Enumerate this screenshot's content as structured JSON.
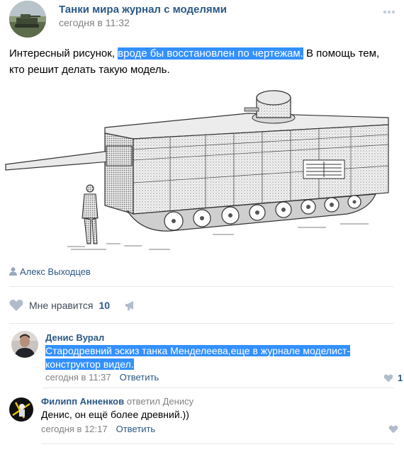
{
  "post": {
    "group_name": "Танки мира журнал с моделями",
    "date": "сегодня в 11:32",
    "text_before": "Интересный рисунок, ",
    "text_highlight": "вроде бы восстановлен по чертежам.",
    "text_after": " В помощь тем, кто решит делать такую модель.",
    "author_signature": "Алекс Выходцев",
    "like_label": "Мне нравится",
    "like_count": "10"
  },
  "comments": [
    {
      "author": "Денис Вурал",
      "text": "Стародревний эскиз танка Менделеева,еще в журнале моделист-конструктор видел.",
      "date": "сегодня в 11:37",
      "reply_label": "Ответить",
      "likes": "1"
    },
    {
      "author": "Филипп Анненков",
      "replied_prefix": "ответил",
      "replied_to": "Денису",
      "text": "Денис, он ещё более древний.))",
      "date": "сегодня в 12:17",
      "reply_label": "Ответить"
    }
  ],
  "icons": {
    "more": "more-dots-icon",
    "person": "person-icon",
    "heart": "heart-icon",
    "share": "megaphone-icon"
  },
  "colors": {
    "link": "#2a5885",
    "muted": "#828282",
    "highlight": "#3390ff",
    "icon": "#b0bccb"
  }
}
